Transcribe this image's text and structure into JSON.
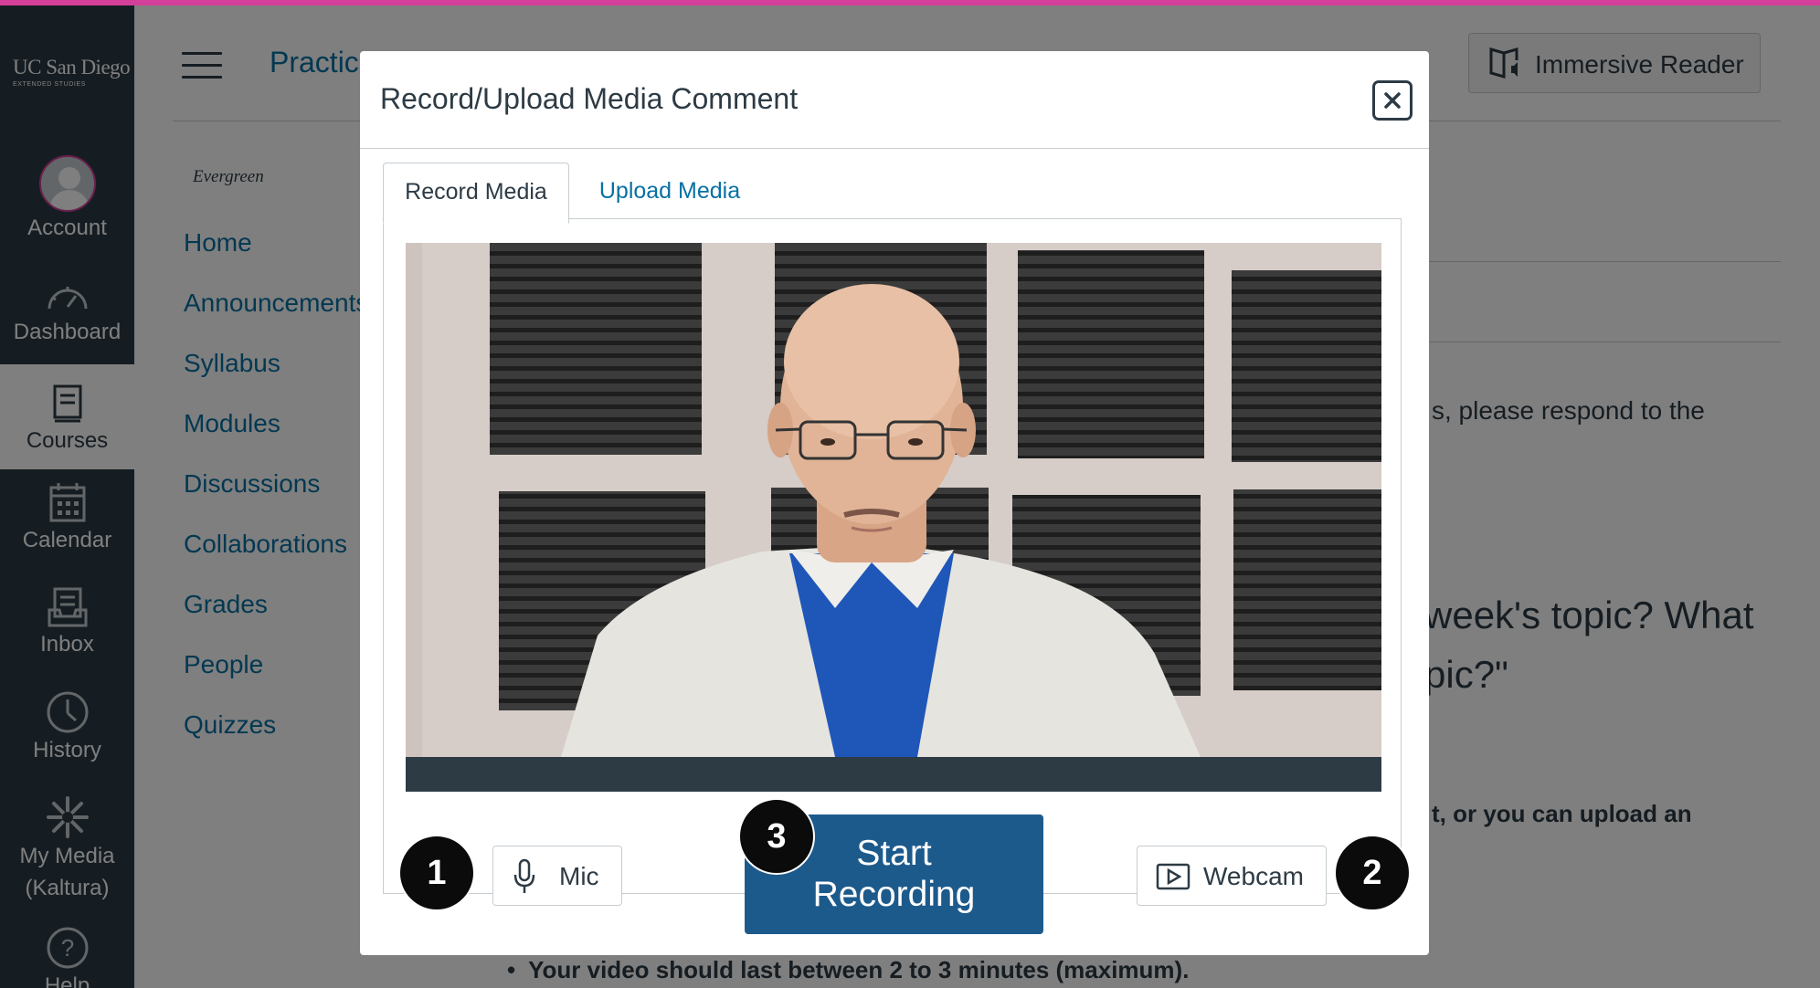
{
  "app": {
    "accent": "#d43f9a",
    "sidebar_bg": "#2d3b45",
    "link_color": "#0770a3",
    "primary_button": "#1d5a8c"
  },
  "sidebar": {
    "logo": {
      "name": "UC San Diego",
      "subtitle": "EXTENDED STUDIES"
    },
    "items": [
      {
        "label": "Account",
        "icon": "user-avatar-icon"
      },
      {
        "label": "Dashboard",
        "icon": "speedometer-icon"
      },
      {
        "label": "Courses",
        "icon": "book-icon",
        "active": true
      },
      {
        "label": "Calendar",
        "icon": "calendar-icon"
      },
      {
        "label": "Inbox",
        "icon": "inbox-icon"
      },
      {
        "label": "History",
        "icon": "clock-icon"
      },
      {
        "label": "My Media (Kaltura)",
        "icon": "kaltura-icon"
      },
      {
        "label": "Help",
        "icon": "question-icon"
      }
    ]
  },
  "header": {
    "page_title": "Practic",
    "immersive_reader": "Immersive Reader"
  },
  "course_nav": {
    "term": "Evergreen",
    "items": [
      "Home",
      "Announcements",
      "Syllabus",
      "Modules",
      "Discussions",
      "Collaborations",
      "Grades",
      "People",
      "Quizzes"
    ]
  },
  "page_content": {
    "line_1": "s, please respond to the",
    "question_1": "week's topic? What",
    "question_2": "pic?\"",
    "line_2": "t, or you can upload an",
    "bullet": "Your video should last between 2 to 3 minutes (maximum)."
  },
  "modal": {
    "title": "Record/Upload Media Comment",
    "close_icon": "close-icon",
    "tabs": [
      {
        "label": "Record Media",
        "selected": true
      },
      {
        "label": "Upload Media",
        "selected": false
      }
    ],
    "controls": {
      "mic_label": "Mic",
      "mic_icon": "microphone-icon",
      "webcam_label": "Webcam",
      "webcam_icon": "video-play-icon",
      "start_label": "Start\nRecording"
    },
    "callouts": [
      "1",
      "2",
      "3"
    ]
  }
}
